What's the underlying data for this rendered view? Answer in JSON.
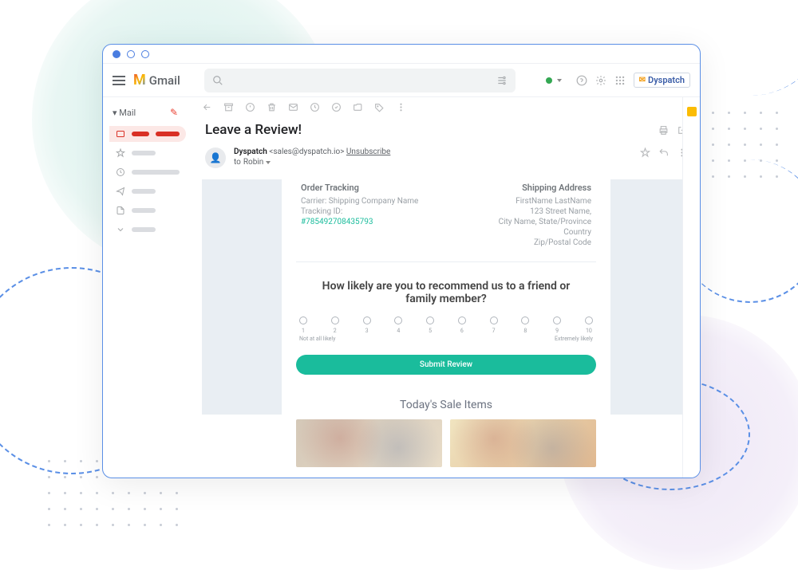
{
  "app": {
    "name": "Gmail"
  },
  "brand_badge": "Dyspatch",
  "sidebar": {
    "mail_label": "Mail",
    "compose_caret": "▾"
  },
  "toolbar": {},
  "email": {
    "subject": "Leave a Review!",
    "sender_name": "Dyspatch",
    "sender_email": "<sales@dyspatch.io>",
    "unsubscribe": "Unsubscribe",
    "to_prefix": "to",
    "to_name": "Robin",
    "order_tracking": {
      "title": "Order Tracking",
      "carrier_label": "Carrier:",
      "carrier_value": "Shipping Company Name",
      "tracking_label": "Tracking ID:",
      "tracking_value": "#785492708435793"
    },
    "shipping": {
      "title": "Shipping Address",
      "name": "FirstName LastName",
      "street": "123 Street Name,",
      "city": "City Name, State/Province",
      "country": "Country",
      "zip": "Zip/Postal Code"
    },
    "question": "How likely are you to recommend us to a friend or family member?",
    "nps_low": "Not at all likely",
    "nps_high": "Extremely likely",
    "nps_values": [
      "1",
      "2",
      "3",
      "4",
      "5",
      "6",
      "7",
      "8",
      "9",
      "10"
    ],
    "submit": "Submit Review",
    "sale_title": "Today's Sale Items"
  }
}
